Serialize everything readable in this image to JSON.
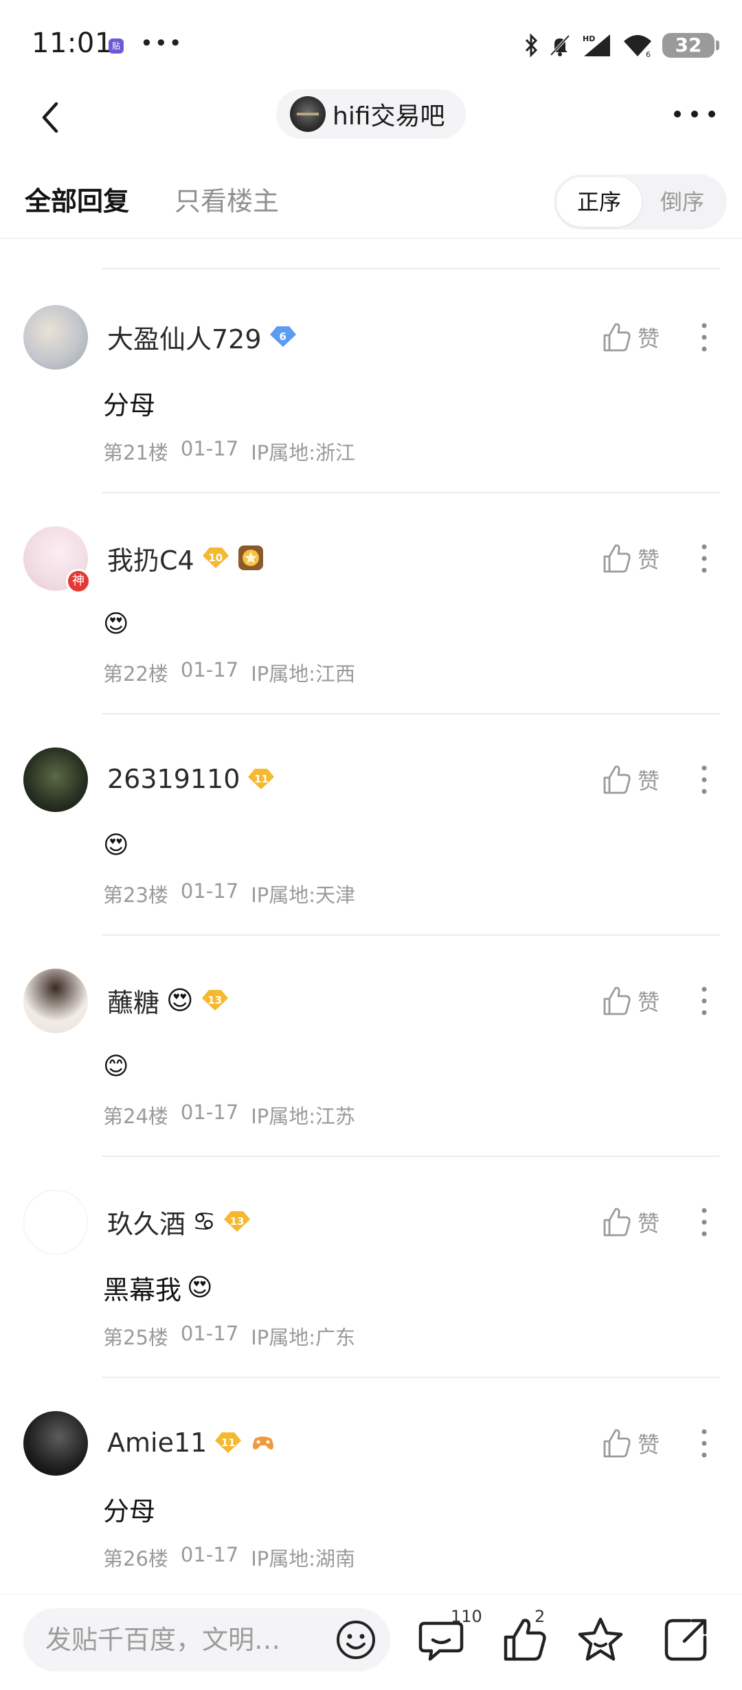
{
  "status_bar": {
    "time": "11:01",
    "app_badge": "贴",
    "dots": "•••",
    "battery": "32"
  },
  "header": {
    "forum_name": "hifi交易吧"
  },
  "tabs": {
    "all": "全部回复",
    "owner_only": "只看楼主",
    "sort_asc": "正序",
    "sort_desc": "倒序"
  },
  "like_label": "赞",
  "posts": [
    {
      "username": "大盈仙人729",
      "level": "6",
      "level_color": "#5b9cf0",
      "content": "分母",
      "floor": "第21楼",
      "date": "01-17",
      "ip": "IP属地:浙江"
    },
    {
      "username": "我扔C4",
      "level": "10",
      "level_color": "#f5b82e",
      "god_badge": "神",
      "content": "😍",
      "floor": "第22楼",
      "date": "01-17",
      "ip": "IP属地:江西"
    },
    {
      "username": "26319110",
      "level": "11",
      "level_color": "#f5b82e",
      "content": "😍",
      "floor": "第23楼",
      "date": "01-17",
      "ip": "IP属地:天津"
    },
    {
      "username": "蘸糖",
      "name_emoji": "😍",
      "level": "13",
      "level_color": "#f5b82e",
      "content": "😊",
      "floor": "第24楼",
      "date": "01-17",
      "ip": "IP属地:江苏"
    },
    {
      "username": "玖久酒",
      "name_emoji": "♋",
      "level": "13",
      "level_color": "#f5b82e",
      "content": "黑幕我",
      "content_emoji": "😍",
      "floor": "第25楼",
      "date": "01-17",
      "ip": "IP属地:广东"
    },
    {
      "username": "Amie11",
      "level": "11",
      "level_color": "#f5b82e",
      "content": "分母",
      "floor": "第26楼",
      "date": "01-17",
      "ip": "IP属地:湖南"
    }
  ],
  "bottom_bar": {
    "input_placeholder": "发贴千百度，文明…",
    "comment_count": "110",
    "like_count": "2"
  }
}
